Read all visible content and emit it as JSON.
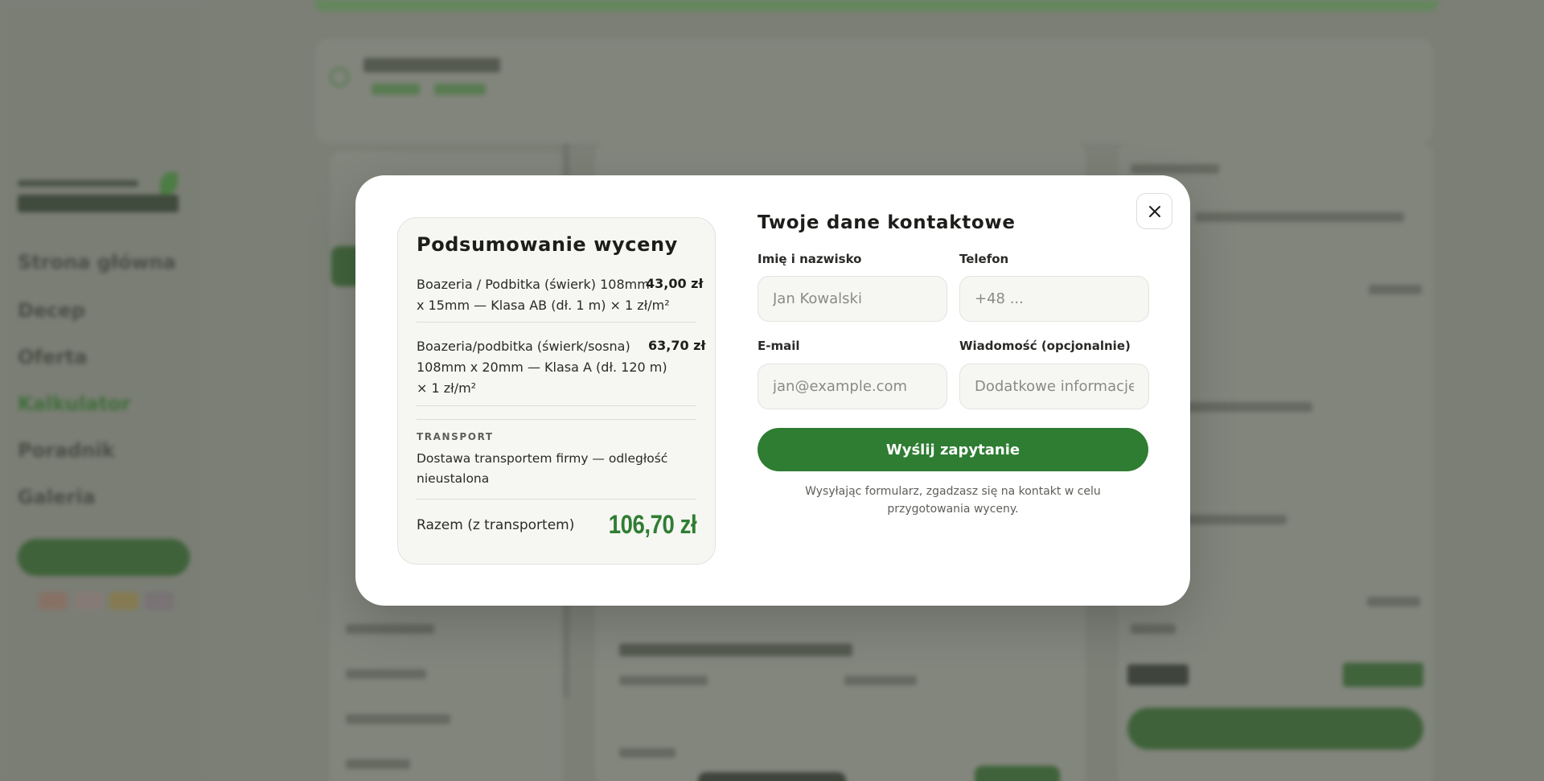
{
  "summary": {
    "title": "Podsumowanie wyceny",
    "items": [
      {
        "line1": "Boazeria / Podbitka (świerk) 108mm",
        "line2": "x 15mm — Klasa AB (dł. 1 m) × 1 zł/m²",
        "price": "43,00 zł"
      },
      {
        "line1": "Boazeria/podbitka (świerk/sosna)",
        "line2": "108mm x 20mm — Klasa A (dł. 120 m)",
        "line3": "× 1 zł/m²",
        "price": "63,70 zł"
      }
    ],
    "transport_label": "TRANSPORT",
    "transport_text": "Dostawa transportem firmy — odległość nieustalona",
    "total_label": "Razem (z transportem)",
    "total_value": "106,70 zł"
  },
  "form": {
    "title": "Twoje dane kontaktowe",
    "name_label": "Imię i nazwisko",
    "name_placeholder": "Jan Kowalski",
    "phone_label": "Telefon",
    "phone_placeholder": "+48 ...",
    "email_label": "E-mail",
    "email_placeholder": "jan@example.com",
    "message_label": "Wiadomość (opcjonalnie)",
    "message_placeholder": "Dodatkowe informacje...",
    "submit_label": "Wyślij zapytanie",
    "consent": "Wysyłając formularz, zgadzasz się na kontakt w celu przygotowania wyceny."
  },
  "background_nav": {
    "items": [
      "Strona główna",
      "Decep",
      "Oferta",
      "Kalkulator",
      "Poradnik",
      "Galeria"
    ]
  },
  "colors": {
    "accent": "#2e7d32",
    "card_bg": "#f6f6f3"
  },
  "icons": {
    "close": "close-icon"
  }
}
